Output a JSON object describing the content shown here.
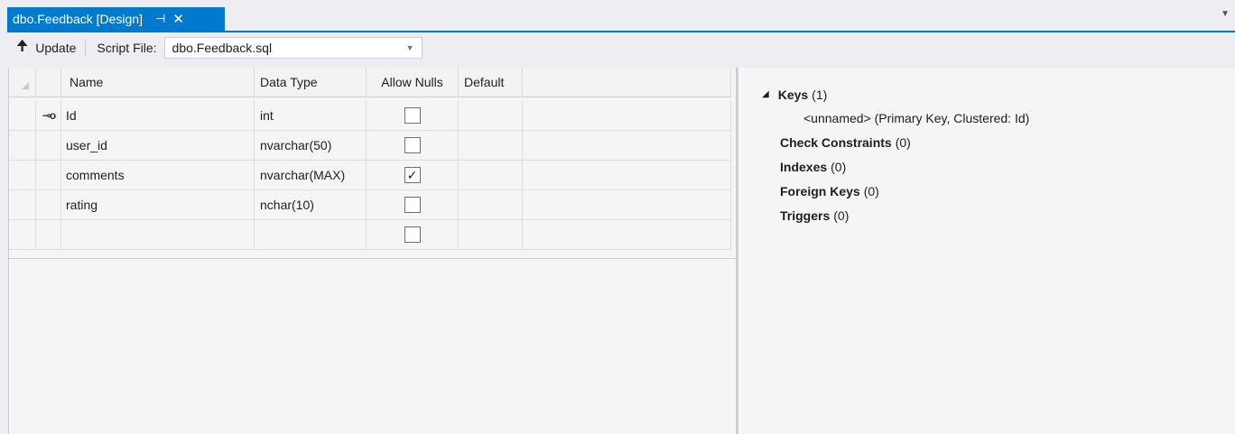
{
  "tab": {
    "title": "dbo.Feedback [Design]",
    "pin": "⊣",
    "close": "✕",
    "accent": "#007acc"
  },
  "toolbar": {
    "update_label": "Update",
    "script_file_label": "Script File:",
    "script_file_value": "dbo.Feedback.sql"
  },
  "grid": {
    "headers": [
      "Name",
      "Data Type",
      "Allow Nulls",
      "Default"
    ],
    "rows": [
      {
        "name": "Id",
        "type": "int",
        "allow_nulls": false,
        "primary_key": true
      },
      {
        "name": "user_id",
        "type": "nvarchar(50)",
        "allow_nulls": false
      },
      {
        "name": "comments",
        "type": "nvarchar(MAX)",
        "allow_nulls": true
      },
      {
        "name": "rating",
        "type": "nchar(10)",
        "allow_nulls": false
      },
      {
        "name": "",
        "type": "",
        "allow_nulls": false
      }
    ]
  },
  "properties": {
    "keys_label": "Keys",
    "keys_count": "(1)",
    "key_item": "<unnamed>  (Primary Key, Clustered: Id)",
    "check_label": "Check Constraints",
    "check_count": "(0)",
    "indexes_label": "Indexes",
    "indexes_count": "(0)",
    "fk_label": "Foreign Keys",
    "fk_count": "(0)",
    "triggers_label": "Triggers",
    "triggers_count": "(0)"
  }
}
